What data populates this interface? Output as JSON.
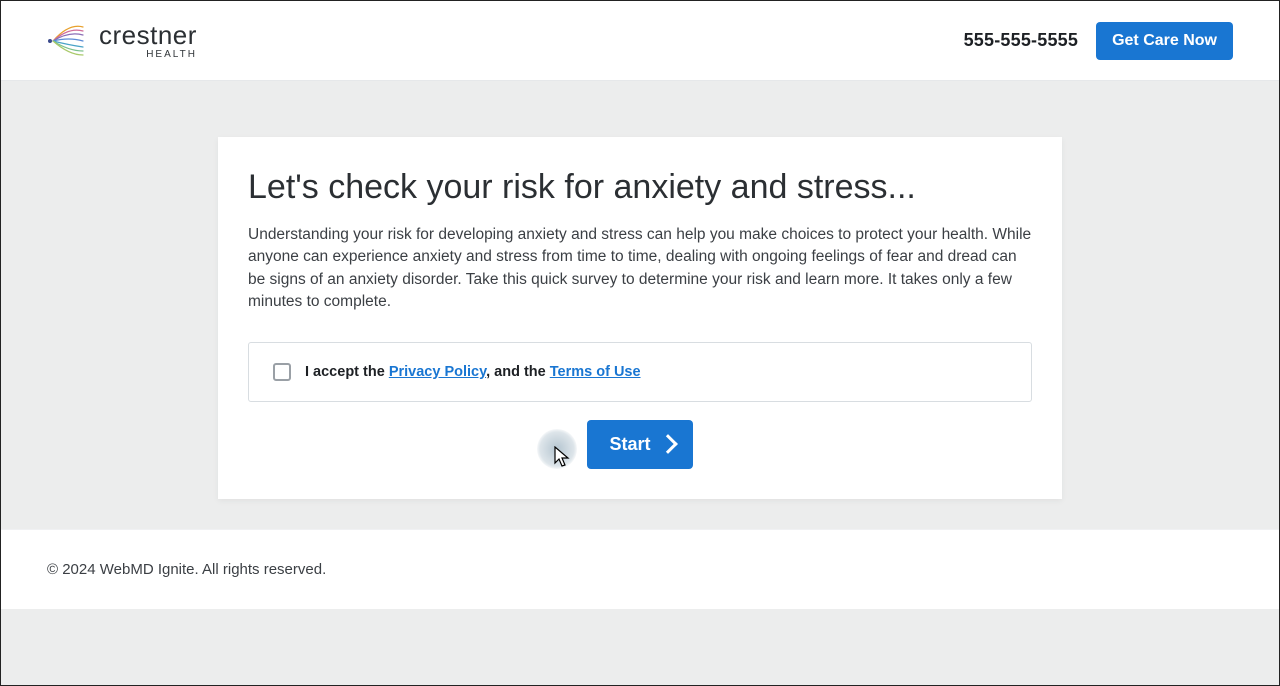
{
  "header": {
    "brand": "crestner",
    "brand_sub": "HEALTH",
    "phone": "555-555-5555",
    "cta_label": "Get Care Now"
  },
  "main": {
    "title": "Let's check your risk for anxiety and stress...",
    "description": "Understanding your risk for developing anxiety and stress can help you make choices to protect your health. While anyone can experience anxiety and stress from time to time, dealing with ongoing feelings of fear and dread can be signs of an anxiety disorder. Take this quick survey to determine your risk and learn more. It takes only a few minutes to complete.",
    "consent": {
      "checked": false,
      "prefix": "I accept the ",
      "privacy_label": "Privacy Policy",
      "middle": ", and the ",
      "terms_label": "Terms of Use"
    },
    "start_label": "Start"
  },
  "footer": {
    "copyright": "© 2024 WebMD Ignite. All rights reserved."
  },
  "colors": {
    "primary": "#1976d2",
    "page_bg": "#eceded"
  }
}
